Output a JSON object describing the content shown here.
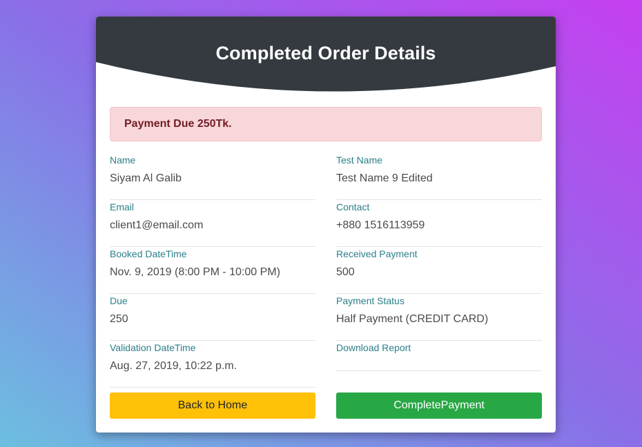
{
  "header": {
    "title": "Completed Order Details"
  },
  "alert": {
    "text": "Payment Due 250Tk."
  },
  "left_fields": [
    {
      "label": "Name",
      "value": "Siyam Al Galib"
    },
    {
      "label": "Email",
      "value": "client1@email.com"
    },
    {
      "label": "Booked DateTime",
      "value": "Nov. 9, 2019 (8:00 PM - 10:00 PM)"
    },
    {
      "label": "Due",
      "value": "250"
    },
    {
      "label": "Validation DateTime",
      "value": "Aug. 27, 2019, 10:22 p.m."
    }
  ],
  "right_fields": [
    {
      "label": "Test Name",
      "value": "Test Name 9 Edited"
    },
    {
      "label": "Contact",
      "value": "+880 1516113959"
    },
    {
      "label": "Received Payment",
      "value": "500"
    },
    {
      "label": "Payment Status",
      "value": "Half Payment (CREDIT CARD)"
    },
    {
      "label": "Download Report",
      "value": ""
    }
  ],
  "buttons": {
    "back_home": "Back to Home",
    "complete_payment": "CompletePayment"
  },
  "colors": {
    "header_bg": "#343a40",
    "alert_bg": "#f8d7da",
    "alert_text": "#721c24",
    "label": "#2a7f8a",
    "warning": "#ffc107",
    "success": "#28a745"
  }
}
